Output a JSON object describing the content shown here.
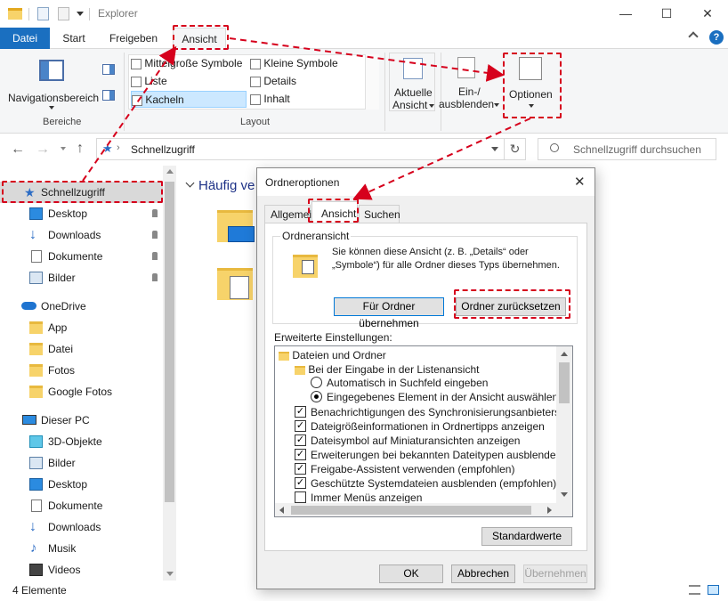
{
  "window": {
    "title": "Explorer",
    "minimize": "—",
    "maximize": "☐",
    "close": "✕"
  },
  "ribbon_tabs": {
    "file": "Datei",
    "start": "Start",
    "share": "Freigeben",
    "view": "Ansicht"
  },
  "ribbon": {
    "nav_pane": "Navigationsbereich",
    "group_panes": "Bereiche",
    "layout_items": {
      "medium": "Mittelgroße Symbole",
      "small": "Kleine Symbole",
      "list": "Liste",
      "details": "Details",
      "tiles": "Kacheln",
      "content": "Inhalt"
    },
    "group_layout": "Layout",
    "current_view_line1": "Aktuelle",
    "current_view_line2": "Ansicht",
    "show_hide_line1": "Ein-/",
    "show_hide_line2": "ausblenden",
    "options": "Optionen"
  },
  "address": {
    "path": "Schnellzugriff",
    "search_placeholder": "Schnellzugriff durchsuchen"
  },
  "nav": {
    "quick_access": "Schnellzugriff",
    "qa_items": [
      "Desktop",
      "Downloads",
      "Dokumente",
      "Bilder"
    ],
    "onedrive": "OneDrive",
    "od_items": [
      "App",
      "Datei",
      "Fotos",
      "Google Fotos"
    ],
    "this_pc": "Dieser PC",
    "pc_items": [
      "3D-Objekte",
      "Bilder",
      "Desktop",
      "Dokumente",
      "Downloads",
      "Musik",
      "Videos"
    ]
  },
  "content": {
    "section": "Häufig ve"
  },
  "status": {
    "count": "4 Elemente"
  },
  "dialog": {
    "title": "Ordneroptionen",
    "tabs": {
      "general": "Allgemein",
      "view": "Ansicht",
      "search": "Suchen"
    },
    "folder_view_title": "Ordneransicht",
    "folder_view_text": "Sie können diese Ansicht (z. B. „Details“ oder „Symbole“) für alle Ordner dieses Typs übernehmen.",
    "apply_button": "Für Ordner übernehmen",
    "reset_button": "Ordner zurücksetzen",
    "advanced_label": "Erweiterte Einstellungen:",
    "tree": {
      "root": "Dateien und Ordner",
      "sub": "Bei der Eingabe in der Listenansicht",
      "radio1": "Automatisch in Suchfeld eingeben",
      "radio2": "Eingegebenes Element in der Ansicht auswählen",
      "checks": [
        {
          "label": "Benachrichtigungen des Synchronisierungsanbieters anzeig",
          "checked": true
        },
        {
          "label": "Dateigrößeinformationen in Ordnertipps anzeigen",
          "checked": true
        },
        {
          "label": "Dateisymbol auf Miniaturansichten anzeigen",
          "checked": true
        },
        {
          "label": "Erweiterungen bei bekannten Dateitypen ausblenden",
          "checked": true
        },
        {
          "label": "Freigabe-Assistent verwenden (empfohlen)",
          "checked": true
        },
        {
          "label": "Geschützte Systemdateien ausblenden (empfohlen)",
          "checked": true
        },
        {
          "label": "Immer Menüs anzeigen",
          "checked": false
        }
      ]
    },
    "defaults_button": "Standardwerte",
    "ok": "OK",
    "cancel": "Abbrechen",
    "apply": "Übernehmen"
  },
  "colors": {
    "accent": "#1a6fc0",
    "highlight": "#d6001c",
    "selection": "#cce8ff"
  }
}
